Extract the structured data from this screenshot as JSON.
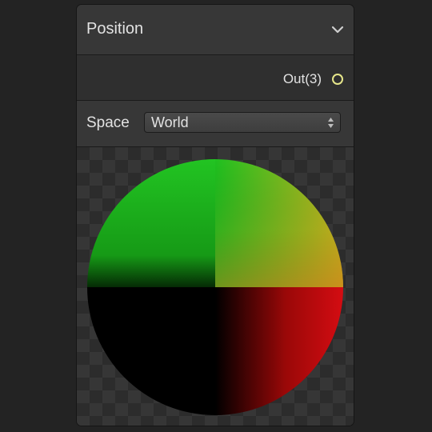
{
  "node": {
    "title": "Position",
    "collapse_icon": "chevron-down-icon"
  },
  "output": {
    "label": "Out(3)",
    "port_icon": "output-port-icon",
    "port_color": "#e6e68a"
  },
  "settings": {
    "space_label": "Space",
    "space_value": "World"
  },
  "preview": {
    "description_icon": "position-sphere-preview",
    "colors": {
      "top_left": "#1ec21e",
      "top_right": "#c0b820",
      "bottom_left": "#000000",
      "bottom_right": "#d00a10"
    }
  }
}
